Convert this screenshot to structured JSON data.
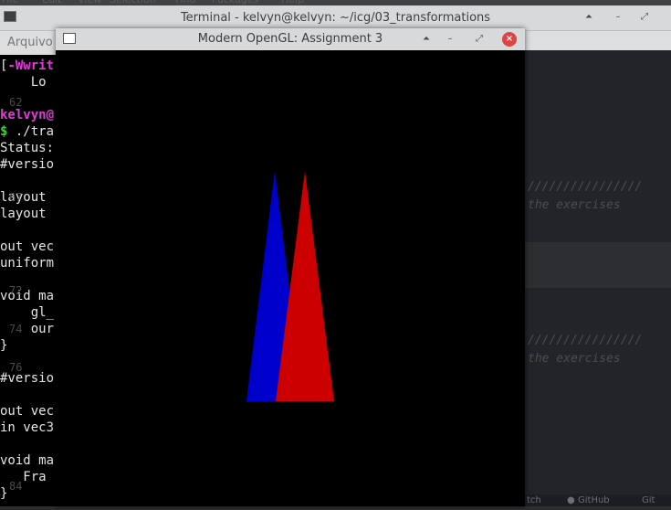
{
  "editor_strip": {
    "items": [
      "File",
      "Edit",
      "View",
      "Selection",
      "Find",
      "Packages",
      "Help"
    ]
  },
  "terminal": {
    "title": "Terminal - kelvyn@kelvyn: ~/icg/03_transformations",
    "menu_first": "Arquivo",
    "lines": [
      {
        "text": "[-Wwrit",
        "style": "pink_prefix"
      },
      {
        "text": "    Lo",
        "style": "plain"
      },
      {
        "text": "",
        "style": "plain"
      },
      {
        "text": "kelvyn@",
        "style": "pink"
      },
      {
        "text": "$ ./tra",
        "style": "green_prefix"
      },
      {
        "text": "Status:",
        "style": "plain"
      },
      {
        "text": "#versio",
        "style": "plain"
      },
      {
        "text": "",
        "style": "plain"
      },
      {
        "text": "layout ",
        "style": "plain"
      },
      {
        "text": "layout ",
        "style": "plain"
      },
      {
        "text": "",
        "style": "plain"
      },
      {
        "text": "out vec",
        "style": "plain"
      },
      {
        "text": "uniform",
        "style": "plain"
      },
      {
        "text": "",
        "style": "plain"
      },
      {
        "text": "void ma",
        "style": "plain"
      },
      {
        "text": "    gl_",
        "style": "plain"
      },
      {
        "text": "    our",
        "style": "plain"
      },
      {
        "text": "}",
        "style": "plain"
      },
      {
        "text": "",
        "style": "plain"
      },
      {
        "text": "#versio",
        "style": "plain"
      },
      {
        "text": "",
        "style": "plain"
      },
      {
        "text": "out vec",
        "style": "plain"
      },
      {
        "text": "in vec3",
        "style": "plain"
      },
      {
        "text": "",
        "style": "plain"
      },
      {
        "text": "void ma",
        "style": "plain"
      },
      {
        "text": "   Fra",
        "style": "plain"
      },
      {
        "text": "}",
        "style": "plain"
      }
    ],
    "gutter_numbers": [
      "62",
      "67",
      "72",
      "74",
      "76",
      "84"
    ]
  },
  "editor_bg": {
    "comment_rule_1": "////////////////",
    "comment_text_1": "the exercises",
    "comment_rule_2": "////////////////",
    "comment_text_2": "the exercises",
    "status_left": "tch",
    "status_github": "GitHub",
    "status_git": "Git"
  },
  "gl_window": {
    "title": "Modern OpenGL: Assignment 3",
    "btn_shade": "⏶",
    "btn_minimize": "–",
    "btn_maximize": "⤢",
    "btn_close": "×",
    "background": "#000000",
    "shapes": [
      {
        "name": "blue-triangle",
        "color": "#0000cc"
      },
      {
        "name": "red-triangle",
        "color": "#cc0000"
      }
    ]
  },
  "term_buttons": {
    "shade": "⏶",
    "minimize": "–",
    "maximize": "⤢",
    "close": "×"
  }
}
